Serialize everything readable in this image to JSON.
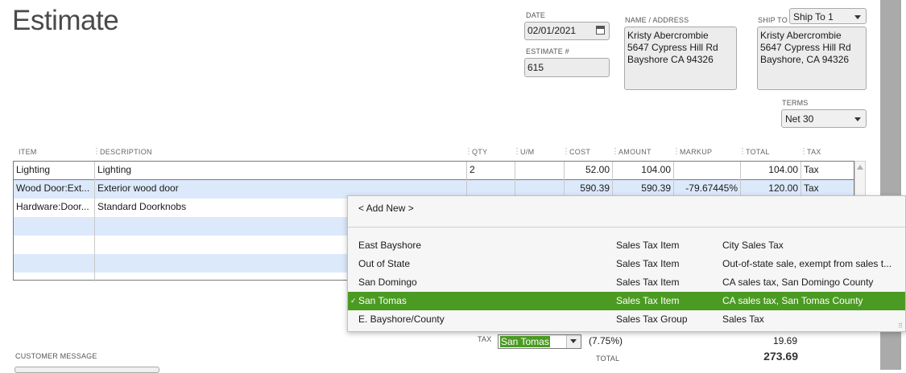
{
  "form": {
    "title": "Estimate"
  },
  "date": {
    "label": "DATE",
    "value": "02/01/2021"
  },
  "estimate_no": {
    "label": "ESTIMATE #",
    "value": "615"
  },
  "name_address": {
    "label": "NAME / ADDRESS",
    "value": "Kristy Abercrombie\n5647 Cypress Hill Rd\nBayshore CA 94326"
  },
  "ship_to": {
    "label": "SHIP TO",
    "selected": "Ship To 1",
    "value": "Kristy Abercrombie\n5647 Cypress Hill Rd\nBayshore, CA 94326"
  },
  "terms": {
    "label": "TERMS",
    "selected": "Net 30"
  },
  "table": {
    "headers": [
      "ITEM",
      "DESCRIPTION",
      "QTY",
      "U/M",
      "COST",
      "AMOUNT",
      "MARKUP",
      "TOTAL",
      "TAX"
    ],
    "rows": [
      {
        "item": "Lighting",
        "description": "Lighting",
        "qty": "2",
        "um": "",
        "cost": "52.00",
        "amount": "104.00",
        "markup": "",
        "total": "104.00",
        "tax": "Tax"
      },
      {
        "item": "Wood Door:Ext...",
        "description": "Exterior wood door",
        "qty": "",
        "um": "",
        "cost": "590.39",
        "amount": "590.39",
        "markup": "-79.67445%",
        "total": "120.00",
        "tax": "Tax"
      },
      {
        "item": "Hardware:Door...",
        "description": "Standard Doorknobs",
        "qty": "",
        "um": "",
        "cost": "",
        "amount": "",
        "markup": "",
        "total": "",
        "tax": ""
      }
    ]
  },
  "tax_dropdown": {
    "add_new": "< Add New >",
    "items": [
      {
        "name": "East Bayshore",
        "type": "Sales Tax Item",
        "description": "City Sales Tax",
        "selected": false
      },
      {
        "name": "Out of State",
        "type": "Sales Tax Item",
        "description": "Out-of-state sale, exempt from sales t...",
        "selected": false
      },
      {
        "name": "San Domingo",
        "type": "Sales Tax Item",
        "description": "CA sales tax, San Domingo County",
        "selected": false
      },
      {
        "name": "San Tomas",
        "type": "Sales Tax Item",
        "description": "CA sales tax, San Tomas County",
        "selected": true
      },
      {
        "name": "E. Bayshore/County",
        "type": "Sales Tax Group",
        "description": "Sales Tax",
        "selected": false
      }
    ],
    "check_mark": "✓"
  },
  "tax": {
    "label": "TAX",
    "value": "San Tomas",
    "rate": "(7.75%)",
    "amount": "19.69"
  },
  "total": {
    "label": "TOTAL",
    "value": "273.69"
  },
  "customer_message": {
    "label": "CUSTOMER MESSAGE"
  },
  "colors": {
    "selection": "#4b9b22",
    "row_alt": "#dce9fb",
    "side_scroll": "#aaaaaa"
  }
}
